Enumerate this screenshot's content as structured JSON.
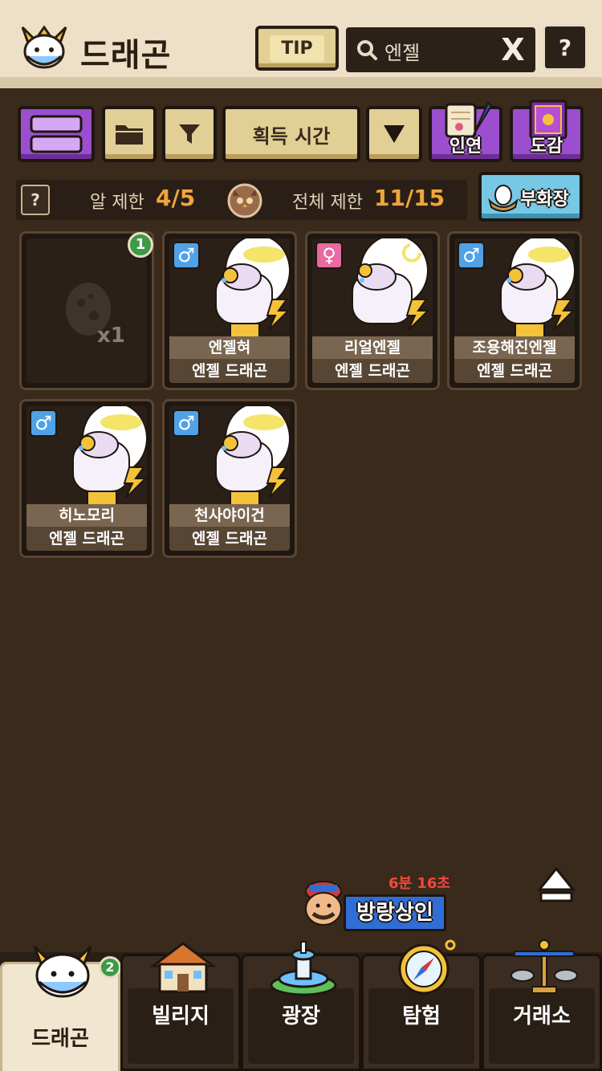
{
  "header": {
    "title": "드래곤",
    "tip_label": "TIP",
    "search_value": "엔젤",
    "clear_label": "X",
    "help_label": "?"
  },
  "toolbar": {
    "sort_label": "획득 시간",
    "bond_label": "인연",
    "book_label": "도감"
  },
  "limits": {
    "help_label": "?",
    "egg_label": "알 제한",
    "egg_value": "4/5",
    "total_label": "전체 제한",
    "total_value": "11/15",
    "incubator_label": "부화장"
  },
  "egg_slot": {
    "count": "x1",
    "badge": "1"
  },
  "dragons": [
    {
      "name": "엔젤혀",
      "type": "엔젤 드래곤",
      "gender": "♂"
    },
    {
      "name": "리얼엔젤",
      "type": "엔젤 드래곤",
      "gender": "♀"
    },
    {
      "name": "조용해진엔젤",
      "type": "엔젤 드래곤",
      "gender": "♂"
    },
    {
      "name": "히노모리",
      "type": "엔젤 드래곤",
      "gender": "♂"
    },
    {
      "name": "천사야이건",
      "type": "엔젤 드래곤",
      "gender": "♂"
    }
  ],
  "merchant": {
    "timer": "6분 16초",
    "label": "방랑상인"
  },
  "nav": {
    "tabs": [
      {
        "label": "드래곤",
        "badge": "2"
      },
      {
        "label": "빌리지"
      },
      {
        "label": "광장"
      },
      {
        "label": "탐험"
      },
      {
        "label": "거래소"
      }
    ]
  },
  "colors": {
    "background": "#3a2a1c",
    "header": "#ede0c6",
    "accent_orange": "#f0a53c",
    "male": "#4fa2e8",
    "female": "#e86aa0",
    "purple_button": "#9b4fcf",
    "incubator": "#76c8e4",
    "merchant_timer": "#f04a3a"
  }
}
